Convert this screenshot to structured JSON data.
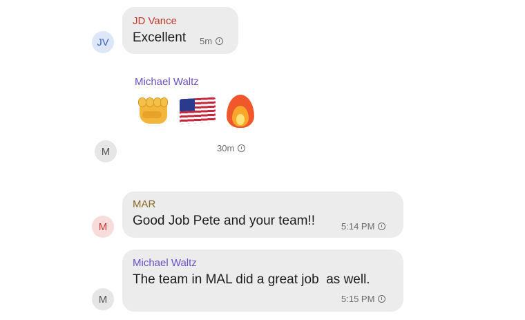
{
  "messages": [
    {
      "avatar_initials": "JV",
      "sender": "JD Vance",
      "text": "Excellent",
      "time": "5m",
      "sender_color": "#c03a2b"
    },
    {
      "avatar_initials": "M",
      "sender": "Michael Waltz",
      "emojis": [
        "oncoming-fist",
        "us-flag",
        "fire"
      ],
      "time": "30m",
      "sender_color": "#6a4fc7"
    },
    {
      "avatar_initials": "M",
      "sender": "MAR",
      "text": "Good Job Pete and your team!!",
      "time": "5:14 PM",
      "sender_color": "#8a6a28"
    },
    {
      "avatar_initials": "M",
      "sender": "Michael Waltz",
      "text": "The team in MAL did a great job  as well.",
      "time": "5:15 PM",
      "sender_color": "#6a4fc7"
    }
  ],
  "colors": {
    "bubble_bg": "#ececec",
    "timestamp": "#6b6b6b"
  }
}
